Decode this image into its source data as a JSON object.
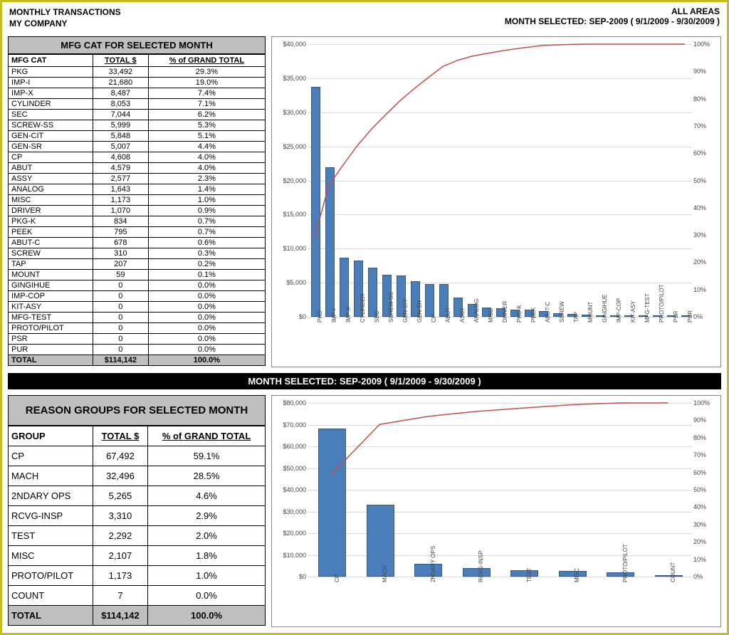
{
  "header": {
    "title_l1": "MONTHLY TRANSACTIONS",
    "title_l2": "MY COMPANY",
    "title_r1": "ALL AREAS",
    "date_line": "MONTH SELECTED:    SEP-2009    (   9/1/2009    -   9/30/2009   )"
  },
  "table1": {
    "caption": "MFG CAT FOR SELECTED MONTH",
    "cols": [
      "MFG CAT",
      "TOTAL $",
      "% of GRAND TOTAL"
    ],
    "rows": [
      [
        "PKG",
        "33,492",
        "29.3%"
      ],
      [
        "IMP-I",
        "21,680",
        "19.0%"
      ],
      [
        "IMP-X",
        "8,487",
        "7.4%"
      ],
      [
        "CYLINDER",
        "8,053",
        "7.1%"
      ],
      [
        "SEC",
        "7,044",
        "6.2%"
      ],
      [
        "SCREW-SS",
        "5,999",
        "5.3%"
      ],
      [
        "GEN-CIT",
        "5,848",
        "5.1%"
      ],
      [
        "GEN-SR",
        "5,007",
        "4.4%"
      ],
      [
        "CP",
        "4,608",
        "4.0%"
      ],
      [
        "ABUT",
        "4,579",
        "4.0%"
      ],
      [
        "ASSY",
        "2,577",
        "2.3%"
      ],
      [
        "ANALOG",
        "1,643",
        "1.4%"
      ],
      [
        "MISC",
        "1,173",
        "1.0%"
      ],
      [
        "DRIVER",
        "1,070",
        "0.9%"
      ],
      [
        "PKG-K",
        "834",
        "0.7%"
      ],
      [
        "PEEK",
        "795",
        "0.7%"
      ],
      [
        "ABUT-C",
        "678",
        "0.6%"
      ],
      [
        "SCREW",
        "310",
        "0.3%"
      ],
      [
        "TAP",
        "207",
        "0.2%"
      ],
      [
        "MOUNT",
        "59",
        "0.1%"
      ],
      [
        "GINGIHUE",
        "0",
        "0.0%"
      ],
      [
        "IMP-COP",
        "0",
        "0.0%"
      ],
      [
        "KIT-ASY",
        "0",
        "0.0%"
      ],
      [
        "MFG-TEST",
        "0",
        "0.0%"
      ],
      [
        "PROTO/PILOT",
        "0",
        "0.0%"
      ],
      [
        "PSR",
        "0",
        "0.0%"
      ],
      [
        "PUR",
        "0",
        "0.0%"
      ]
    ],
    "total": [
      "TOTAL",
      "$114,142",
      "100.0%"
    ]
  },
  "table2": {
    "caption": "REASON GROUPS FOR SELECTED MONTH",
    "cols": [
      "GROUP",
      "TOTAL $",
      "% of GRAND TOTAL"
    ],
    "rows": [
      [
        "CP",
        "67,492",
        "59.1%"
      ],
      [
        "MACH",
        "32,496",
        "28.5%"
      ],
      [
        "2NDARY OPS",
        "5,265",
        "4.6%"
      ],
      [
        "RCVG-INSP",
        "3,310",
        "2.9%"
      ],
      [
        "TEST",
        "2,292",
        "2.0%"
      ],
      [
        "MISC",
        "2,107",
        "1.8%"
      ],
      [
        "PROTO/PILOT",
        "1,173",
        "1.0%"
      ],
      [
        "COUNT",
        "7",
        "0.0%"
      ]
    ],
    "total": [
      "TOTAL",
      "$114,142",
      "100.0%"
    ]
  },
  "strip_text": "MONTH SELECTED:    SEP-2009    (   9/1/2009    -   9/30/2009   )",
  "chart_data": [
    {
      "type": "pareto",
      "categories": [
        "PKG",
        "IMP-I",
        "IMP-X",
        "CYLINDER",
        "SEC",
        "SCREW-SS",
        "GEN-CIT",
        "GEN-SR",
        "CP",
        "ABUT",
        "ASSY",
        "ANALOG",
        "MISC",
        "DRIVER",
        "PKG-K",
        "PEEK",
        "ABUT-C",
        "SCREW",
        "TAP",
        "MOUNT",
        "GINGIHUE",
        "IMP-COP",
        "KIT-ASY",
        "MFG-TEST",
        "PROTO/PILOT",
        "PSR",
        "PUR"
      ],
      "values": [
        33492,
        21680,
        8487,
        8053,
        7044,
        5999,
        5848,
        5007,
        4608,
        4579,
        2577,
        1643,
        1173,
        1070,
        834,
        795,
        678,
        310,
        207,
        59,
        0,
        0,
        0,
        0,
        0,
        0,
        0
      ],
      "cumulative_pct": [
        29.3,
        48.3,
        55.7,
        62.8,
        68.9,
        74.2,
        79.3,
        83.7,
        87.8,
        91.8,
        94.0,
        95.5,
        96.5,
        97.4,
        98.2,
        98.9,
        99.5,
        99.7,
        99.9,
        100.0,
        100.0,
        100.0,
        100.0,
        100.0,
        100.0,
        100.0,
        100.0
      ],
      "ylim_left": [
        0,
        40000
      ],
      "ytick_left": 5000,
      "ylabel_left_fmt": "$#,##0",
      "ylim_right": [
        0,
        100
      ],
      "ytick_right": 10,
      "ylabel_right_fmt": "0%",
      "bar_color": "#4a7ebb",
      "line_color": "#c0504d"
    },
    {
      "type": "pareto",
      "categories": [
        "CP",
        "MACH",
        "2NDARY OPS",
        "RCVG-INSP",
        "TEST",
        "MISC",
        "PROTO/PILOT",
        "COUNT"
      ],
      "values": [
        67492,
        32496,
        5265,
        3310,
        2292,
        2107,
        1173,
        7
      ],
      "cumulative_pct": [
        59.1,
        87.6,
        92.2,
        95.1,
        97.1,
        99.0,
        100.0,
        100.0
      ],
      "ylim_left": [
        0,
        80000
      ],
      "ytick_left": 10000,
      "ylabel_left_fmt": "$#,##0",
      "ylim_right": [
        0,
        100
      ],
      "ytick_right": 10,
      "ylabel_right_fmt": "0%",
      "bar_color": "#4a7ebb",
      "line_color": "#c0504d"
    }
  ]
}
